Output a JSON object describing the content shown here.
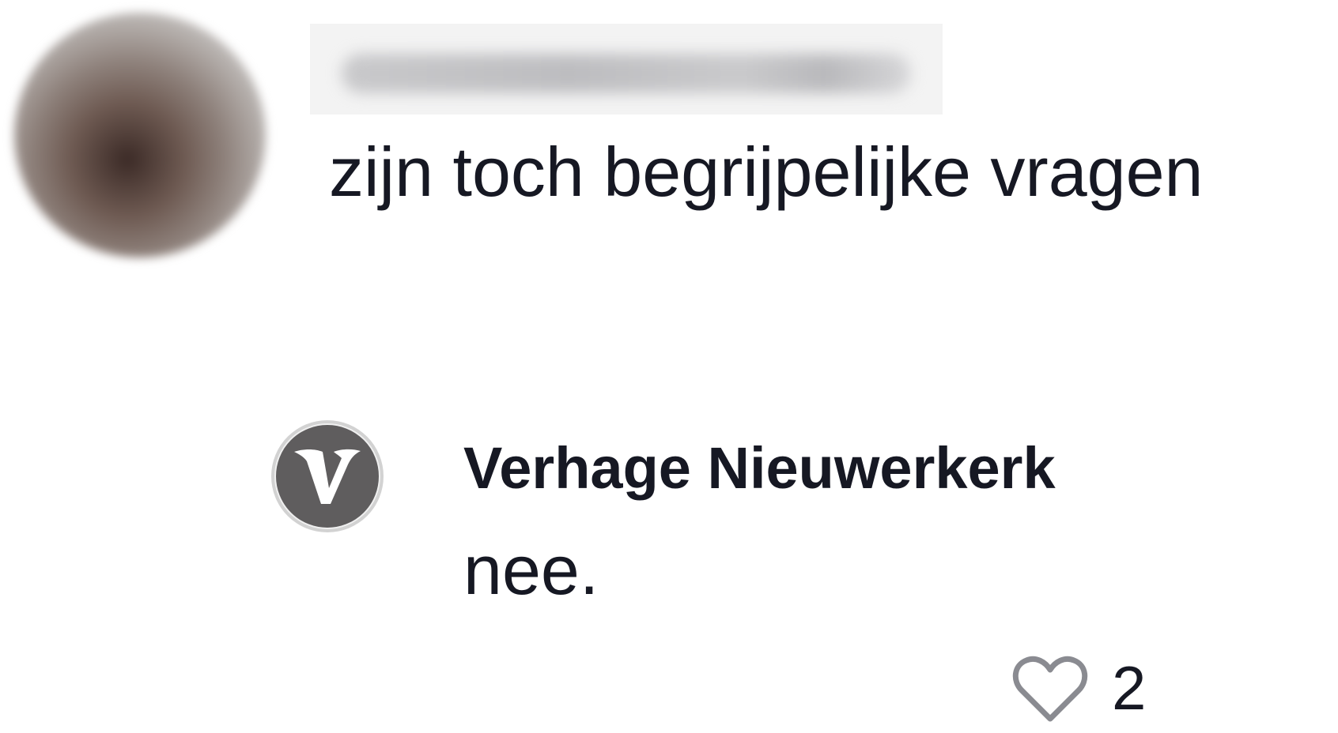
{
  "comment": {
    "author_avatar": "blurred-user-avatar",
    "author_name_hidden": true,
    "text": "zijn toch begrijpelijke vragen"
  },
  "reply": {
    "author_avatar": "verhage-logo",
    "author_name": "Verhage Nieuwerkerk",
    "text": "nee.",
    "like_icon": "heart-outline-icon",
    "like_count": "2"
  },
  "colors": {
    "text": "#161823",
    "background": "#ffffff",
    "logo_background": "#5f5d5e",
    "icon_gray": "#8a8b91"
  }
}
